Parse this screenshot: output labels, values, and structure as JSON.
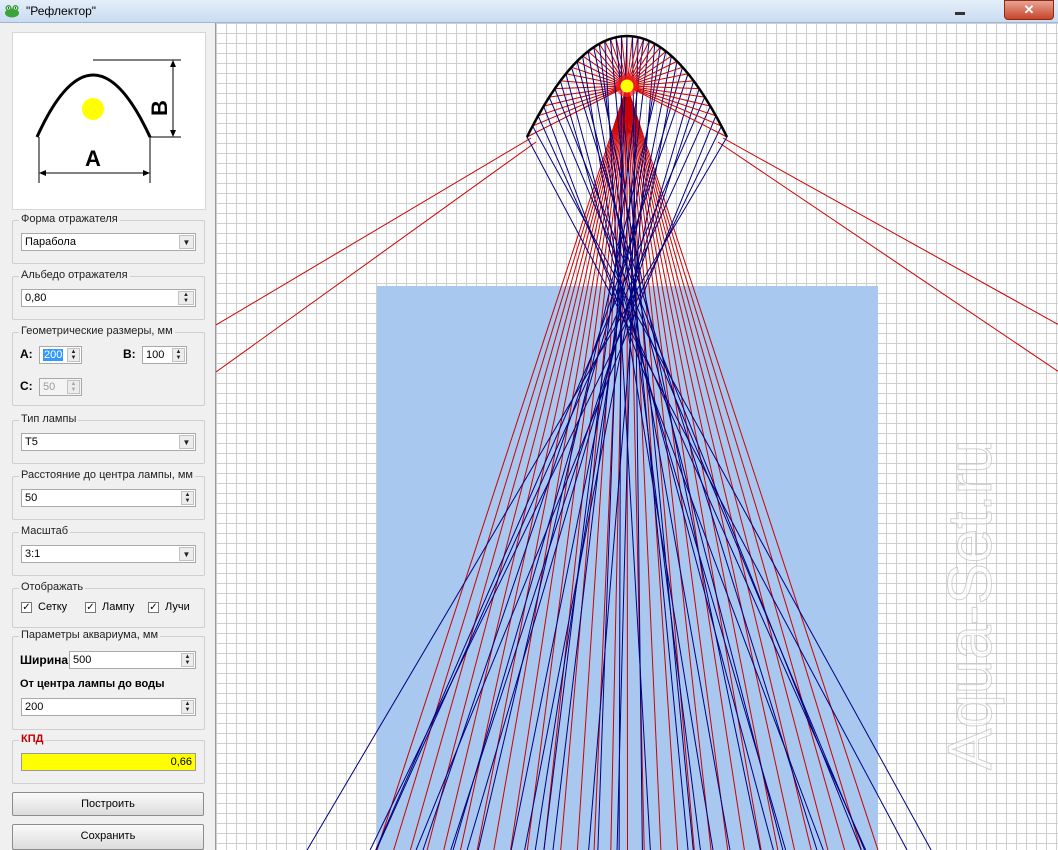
{
  "window": {
    "title": "\"Рефлектор\"",
    "close_glyph": "✕"
  },
  "preview": {
    "label_a": "A",
    "label_b": "B"
  },
  "reflector_shape": {
    "title": "Форма отражателя",
    "value": "Парабола"
  },
  "albedo": {
    "title": "Альбедо отражателя",
    "value": "0,80"
  },
  "dimensions": {
    "title": "Геометрические размеры, мм",
    "a_label": "A:",
    "a_value": "200",
    "b_label": "B:",
    "b_value": "100",
    "c_label": "C:",
    "c_value": "50"
  },
  "lamp_type": {
    "title": "Тип лампы",
    "value": "T5"
  },
  "lamp_distance": {
    "title": "Расстояние до центра лампы, мм",
    "value": "50"
  },
  "scale": {
    "title": "Масштаб",
    "value": "3:1"
  },
  "display": {
    "title": "Отображать",
    "options": [
      {
        "label": "Сетку",
        "checked": true
      },
      {
        "label": "Лампу",
        "checked": true
      },
      {
        "label": "Лучи",
        "checked": true
      }
    ]
  },
  "aquarium": {
    "title": "Параметры аквариума, мм",
    "width_label": "Ширина",
    "width_value": "500",
    "distance_label": "От центра лампы до воды",
    "distance_value": "200"
  },
  "efficiency": {
    "title": "КПД",
    "value": "0,66"
  },
  "buttons": {
    "build": "Построить",
    "save": "Сохранить"
  },
  "watermark": "Aqua-Set.ru",
  "colors": {
    "water": "#a8c8f0",
    "ray_reflected": "#000080",
    "ray_direct": "#cc0000",
    "reflector": "#000000",
    "lamp": "#ffff00",
    "efficiency_bg": "#ffff00"
  }
}
